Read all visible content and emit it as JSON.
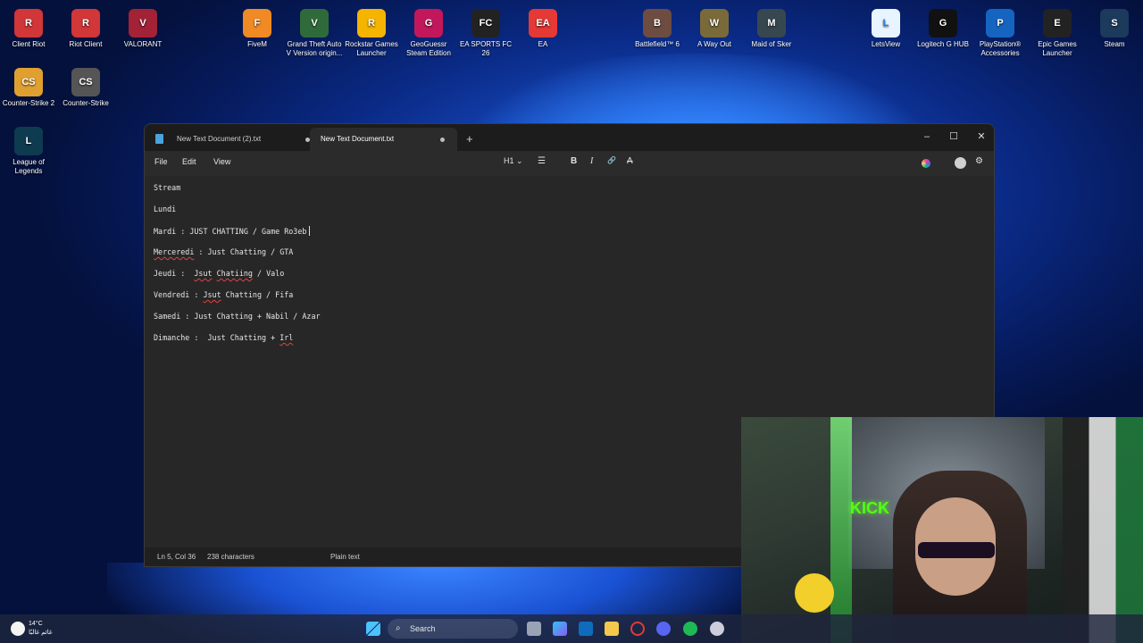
{
  "desktop": {
    "icons": [
      {
        "label": "Client Riot",
        "color": "#d13639",
        "glyph": "R"
      },
      {
        "label": "Riot Client",
        "color": "#d13639",
        "glyph": "R"
      },
      {
        "label": "VALORANT",
        "color": "#a32235",
        "glyph": "V"
      },
      {
        "label": "FiveM",
        "color": "#f08a24",
        "glyph": "F"
      },
      {
        "label": "Grand Theft Auto V Version origin...",
        "color": "#2f6b3a",
        "glyph": "V"
      },
      {
        "label": "Rockstar Games Launcher",
        "color": "#f4b400",
        "glyph": "R"
      },
      {
        "label": "GeoGuessr Steam Edition",
        "color": "#c2185b",
        "glyph": "G"
      },
      {
        "label": "EA SPORTS FC 26",
        "color": "#222222",
        "glyph": "FC"
      },
      {
        "label": "EA",
        "color": "#e53935",
        "glyph": "EA"
      },
      {
        "label": "Battlefield™ 6",
        "color": "#6d4c41",
        "glyph": "B"
      },
      {
        "label": "A Way Out",
        "color": "#7a6a3a",
        "glyph": "W"
      },
      {
        "label": "Maid of Sker",
        "color": "#37474f",
        "glyph": "M"
      },
      {
        "label": "LetsView",
        "color": "#e8f4ff",
        "glyph": "L"
      },
      {
        "label": "Logitech G HUB",
        "color": "#111111",
        "glyph": "G"
      },
      {
        "label": "PlayStation® Accessories",
        "color": "#1565c0",
        "glyph": "P"
      },
      {
        "label": "Epic Games Launcher",
        "color": "#222222",
        "glyph": "E"
      },
      {
        "label": "Steam",
        "color": "#1b3a5c",
        "glyph": "S"
      },
      {
        "label": "Counter-Strike 2",
        "color": "#e0a030",
        "glyph": "CS"
      },
      {
        "label": "Counter-Strike",
        "color": "#555555",
        "glyph": "CS"
      },
      {
        "label": "League of Legends",
        "color": "#0e3b4f",
        "glyph": "L"
      }
    ]
  },
  "notepad": {
    "tabs": [
      {
        "title": "New Text Document (2).txt"
      },
      {
        "title": "New Text Document.txt"
      }
    ],
    "menus": {
      "file": "File",
      "edit": "Edit",
      "view": "View"
    },
    "toolbar": {
      "heading": "H1",
      "heading_chevron": "⌄",
      "list": "☰",
      "bold": "B",
      "italic": "I",
      "link": "🔗",
      "clear": "A"
    },
    "lines": [
      {
        "segments": [
          {
            "text": "Stream"
          }
        ]
      },
      {
        "segments": [
          {
            "text": "Lundi"
          }
        ]
      },
      {
        "segments": [
          {
            "text": "Mardi : JUST CHATTING / Game Ro3eb"
          }
        ]
      },
      {
        "segments": [
          {
            "text": "Merceredi",
            "spell": true
          },
          {
            "text": " : Just Chatting / GTA"
          }
        ]
      },
      {
        "segments": [
          {
            "text": "Jeudi :  "
          },
          {
            "text": "Jsut",
            "spell": true
          },
          {
            "text": " "
          },
          {
            "text": "Chatiing",
            "spell": true
          },
          {
            "text": " / Valo"
          }
        ]
      },
      {
        "segments": [
          {
            "text": "Vendredi : "
          },
          {
            "text": "Jsut",
            "spell": true
          },
          {
            "text": " Chatting / Fifa"
          }
        ]
      },
      {
        "segments": [
          {
            "text": "Samedi : Just Chatting + Nabil / Azar"
          }
        ]
      },
      {
        "segments": [
          {
            "text": "Dimanche :  Just Chatting + "
          },
          {
            "text": "Irl",
            "spell": true
          }
        ]
      }
    ],
    "status": {
      "position": "Ln 5, Col 36",
      "characters": "238 characters",
      "format": "Plain text"
    }
  },
  "webcam": {
    "sign_text": "KICK"
  },
  "taskbar": {
    "weather_temp": "14°C",
    "weather_desc": "غائم غالبًا",
    "search_placeholder": "Search"
  }
}
